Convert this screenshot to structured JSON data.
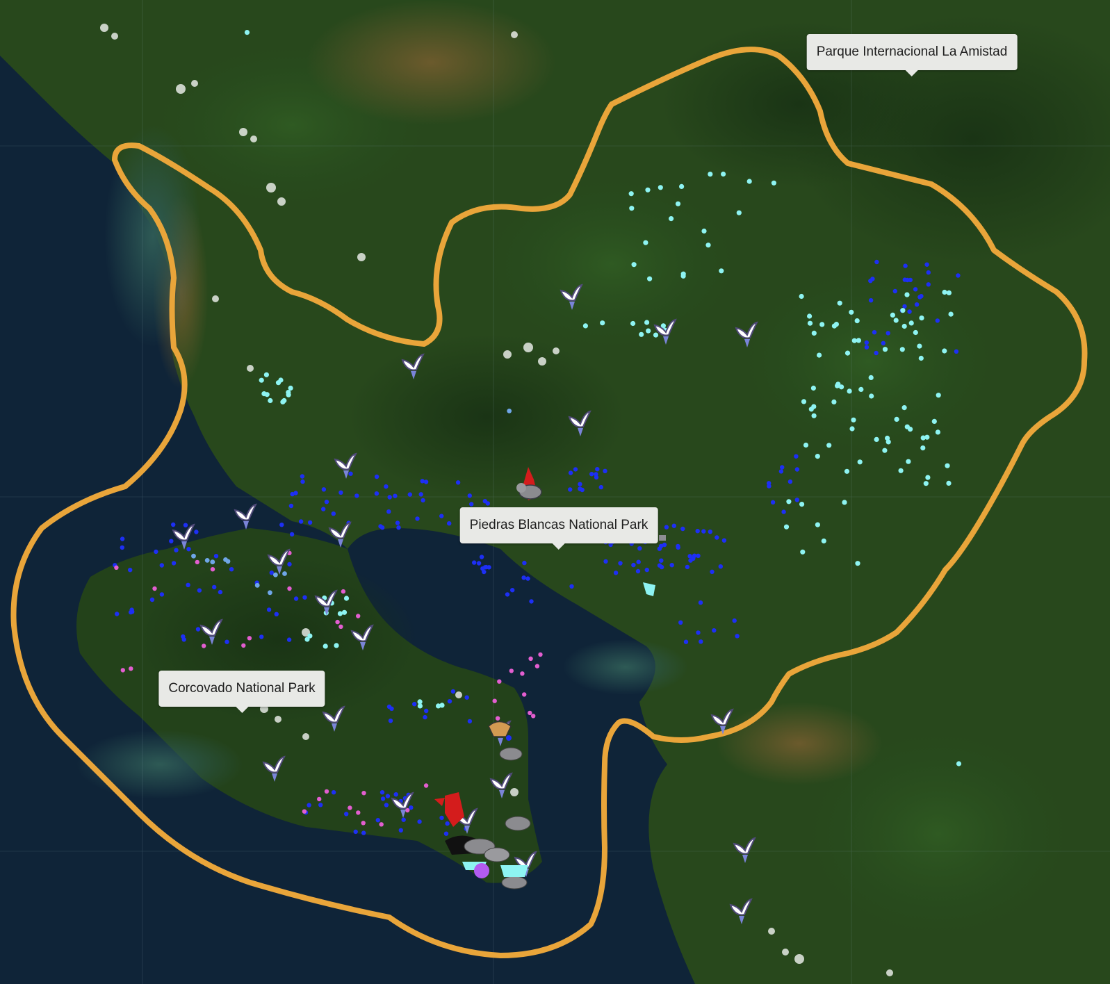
{
  "map": {
    "basemap": "satellite imagery",
    "boundary_color": "#e9a53a",
    "marker_colors": {
      "blue": "#1d2ff5",
      "cyan": "#8ef4f2",
      "pink": "#e35ed0",
      "light_blue": "#6fa6e8",
      "purple": "#b35bf0",
      "red": "#d41c1c"
    },
    "park_labels": [
      {
        "name": "Parque Internacional La Amistad"
      },
      {
        "name": "Piedras Blancas National Park"
      },
      {
        "name": "Corcovado National Park"
      }
    ],
    "icons": [
      "bird-icon",
      "tapir-icon",
      "monkey-icon",
      "jaguar-icon",
      "deer-icon",
      "fish-icon"
    ]
  }
}
